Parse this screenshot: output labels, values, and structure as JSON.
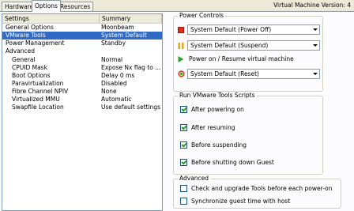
{
  "tabs": [
    {
      "label": "Hardware",
      "active": false
    },
    {
      "label": "Options",
      "active": true
    },
    {
      "label": "Resources",
      "active": false
    }
  ],
  "vm_version": "Virtual Machine Version: 4",
  "settings_list": {
    "columns": [
      "Settings",
      "Summary"
    ],
    "rows": [
      {
        "setting": "General Options",
        "summary": "Moonbeam",
        "selected": false,
        "child": false
      },
      {
        "setting": "VMware Tools",
        "summary": "System Default",
        "selected": true,
        "child": false
      },
      {
        "setting": "Power Management",
        "summary": "Standby",
        "selected": false,
        "child": false
      },
      {
        "setting": "Advanced",
        "summary": "",
        "selected": false,
        "child": false
      },
      {
        "setting": "General",
        "summary": "Normal",
        "selected": false,
        "child": true
      },
      {
        "setting": "CPUID Mask",
        "summary": "Expose Nx flag to ...",
        "selected": false,
        "child": true
      },
      {
        "setting": "Boot Options",
        "summary": "Delay 0 ms",
        "selected": false,
        "child": true
      },
      {
        "setting": "Paravirtualization",
        "summary": "Disabled",
        "selected": false,
        "child": true
      },
      {
        "setting": "Fibre Channel NPIV",
        "summary": "None",
        "selected": false,
        "child": true
      },
      {
        "setting": "Virtualized MMU",
        "summary": "Automatic",
        "selected": false,
        "child": true
      },
      {
        "setting": "Swapfile Location",
        "summary": "Use default settings",
        "selected": false,
        "child": true
      }
    ]
  },
  "power_controls": {
    "title": "Power Controls",
    "stop_select": "System Default (Power Off)",
    "suspend_select": "System Default (Suspend)",
    "power_on_label": "Power on / Resume virtual machine",
    "reset_select": "System Default (Reset)",
    "icons": [
      "stop-icon",
      "pause-icon",
      "play-icon",
      "reset-icon"
    ],
    "colors": {
      "stop": "#d9301c",
      "pause": "#e5a81c",
      "play": "#2fa32f",
      "reset": "#d2411b"
    }
  },
  "tools_scripts": {
    "title": "Run VMware Tools Scripts",
    "items": [
      {
        "label": "After powering on",
        "checked": true
      },
      {
        "label": "After resuming",
        "checked": true
      },
      {
        "label": "Before suspending",
        "checked": true
      },
      {
        "label": "Before shutting down Guest",
        "checked": true
      }
    ]
  },
  "advanced": {
    "title": "Advanced",
    "items": [
      {
        "label": "Check and upgrade Tools before each power-on",
        "checked": false
      },
      {
        "label": "Synchronize guest time with host",
        "checked": false
      }
    ]
  }
}
